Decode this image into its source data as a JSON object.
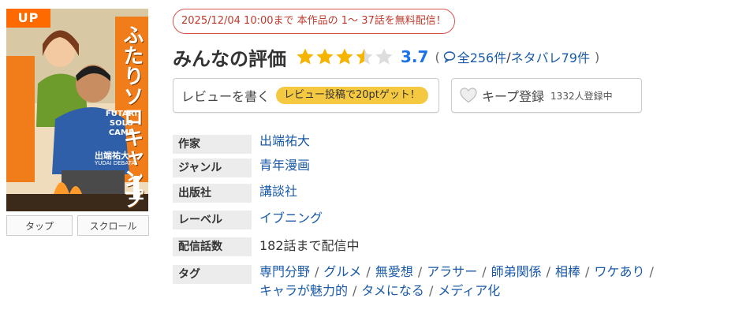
{
  "cover": {
    "badge": "UP",
    "title_vertical": "ふたりソロキャンプ",
    "logo_en": "FUTARI SOLO CAMP",
    "volume": "1",
    "author_on_cover": "出端祐大",
    "author_romaji": "YUDAI DEBATA"
  },
  "view_modes": [
    "タップ",
    "スクロール"
  ],
  "promo": {
    "text": "2025/12/04 10:00まで 本作品の 1〜 37話を無料配信！"
  },
  "rating": {
    "title": "みんなの評価",
    "score": "3.7",
    "stars_fill": 0.74,
    "paren_open": "(",
    "total": "全256件",
    "slash": "/",
    "spoiler": "ネタバレ79件",
    "paren_close": ")"
  },
  "review_button": {
    "label": "レビューを書く",
    "bonus": "レビュー投稿で20ptゲット！"
  },
  "keep_button": {
    "label": "キープ登録",
    "count": "1332人登録中"
  },
  "info": {
    "author_label": "作家",
    "author": "出端祐大",
    "genre_label": "ジャンル",
    "genre": "青年漫画",
    "publisher_label": "出版社",
    "publisher": "講談社",
    "label_label": "レーベル",
    "label": "イブニング",
    "episodes_label": "配信話数",
    "episodes": "182話まで配信中",
    "tags_label": "タグ",
    "tags": [
      "専門分野",
      "グルメ",
      "無愛想",
      "アラサー",
      "師弟関係",
      "相棒",
      "ワケあり",
      "キャラが魅力的",
      "タメになる",
      "メディア化"
    ]
  },
  "colors": {
    "accent": "#1a73e8",
    "link": "#1a5aa8",
    "star": "#f5b400",
    "promo": "#c0392b",
    "pill": "#f5c842",
    "badge": "#ff6a00"
  }
}
